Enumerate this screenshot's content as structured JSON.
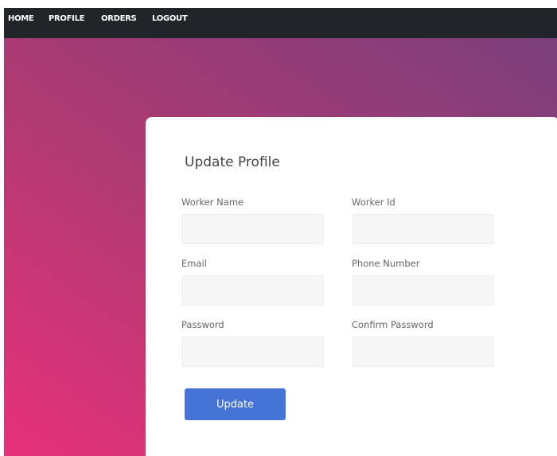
{
  "nav": {
    "items": [
      {
        "label": "HOME"
      },
      {
        "label": "PROFILE"
      },
      {
        "label": "ORDERS"
      },
      {
        "label": "LOGOUT"
      }
    ]
  },
  "form": {
    "title": "Update Profile",
    "fields": {
      "worker_name": {
        "label": "Worker Name",
        "value": ""
      },
      "worker_id": {
        "label": "Worker Id",
        "value": ""
      },
      "email": {
        "label": "Email",
        "value": ""
      },
      "phone_number": {
        "label": "Phone Number",
        "value": ""
      },
      "password": {
        "label": "Password",
        "value": ""
      },
      "confirm_password": {
        "label": "Confirm Password",
        "value": ""
      }
    },
    "submit_label": "Update"
  },
  "colors": {
    "navbar": "#212529",
    "gradient_start": "#e8317a",
    "gradient_end": "#7b3f7c",
    "button": "#4573d6",
    "input_bg": "#f6f6f6"
  }
}
